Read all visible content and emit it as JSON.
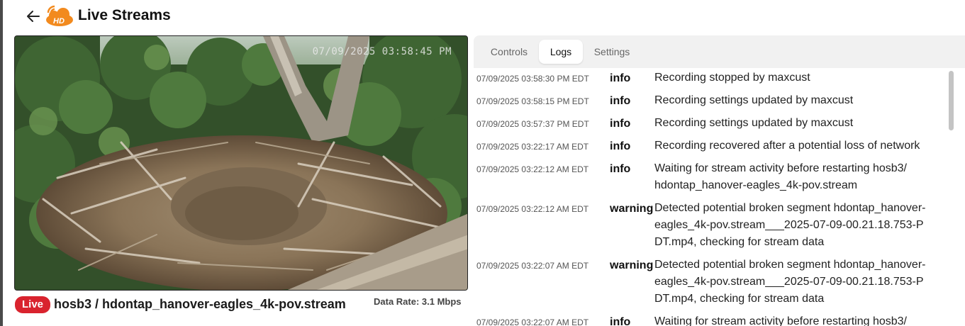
{
  "header": {
    "title": "Live Streams",
    "back_icon": "arrow-left-icon",
    "logo_icon": "hd-logo-icon",
    "logo_text": "HD",
    "logo_color": "#f28a1e"
  },
  "video": {
    "timestamp": "07/09/2025 03:58:45 PM"
  },
  "stream": {
    "live_label": "Live",
    "name": "hosb3 / hdontap_hanover-eagles_4k-pov.stream",
    "data_rate": "Data Rate: 3.1 Mbps",
    "live_color": "#d9232e"
  },
  "tabs": [
    {
      "label": "Controls",
      "active": false
    },
    {
      "label": "Logs",
      "active": true
    },
    {
      "label": "Settings",
      "active": false
    }
  ],
  "logs": [
    {
      "time": "07/09/2025 03:58:30 PM EDT",
      "level": "info",
      "message": "Recording stopped by maxcust"
    },
    {
      "time": "07/09/2025 03:58:15 PM EDT",
      "level": "info",
      "message": "Recording settings updated by maxcust"
    },
    {
      "time": "07/09/2025 03:57:37 PM EDT",
      "level": "info",
      "message": "Recording settings updated by maxcust"
    },
    {
      "time": "07/09/2025 03:22:17 AM EDT",
      "level": "info",
      "message": "Recording recovered after a potential loss of network"
    },
    {
      "time": "07/09/2025 03:22:12 AM EDT",
      "level": "info",
      "message": "Waiting for stream activity before restarting hosb3/ hdontap_hanover-eagles_4k-pov.stream"
    },
    {
      "time": "07/09/2025 03:22:12 AM EDT",
      "level": "warning",
      "message": "Detected potential broken segment hdontap_hanover-eagles_4k-pov.stream___2025-07-09-00.21.18.753-PDT.mp4, checking for stream data"
    },
    {
      "time": "07/09/2025 03:22:07 AM EDT",
      "level": "warning",
      "message": "Detected potential broken segment hdontap_hanover-eagles_4k-pov.stream___2025-07-09-00.21.18.753-PDT.mp4, checking for stream data"
    },
    {
      "time": "07/09/2025 03:22:07 AM EDT",
      "level": "info",
      "message": "Waiting for stream activity before restarting hosb3/"
    }
  ]
}
